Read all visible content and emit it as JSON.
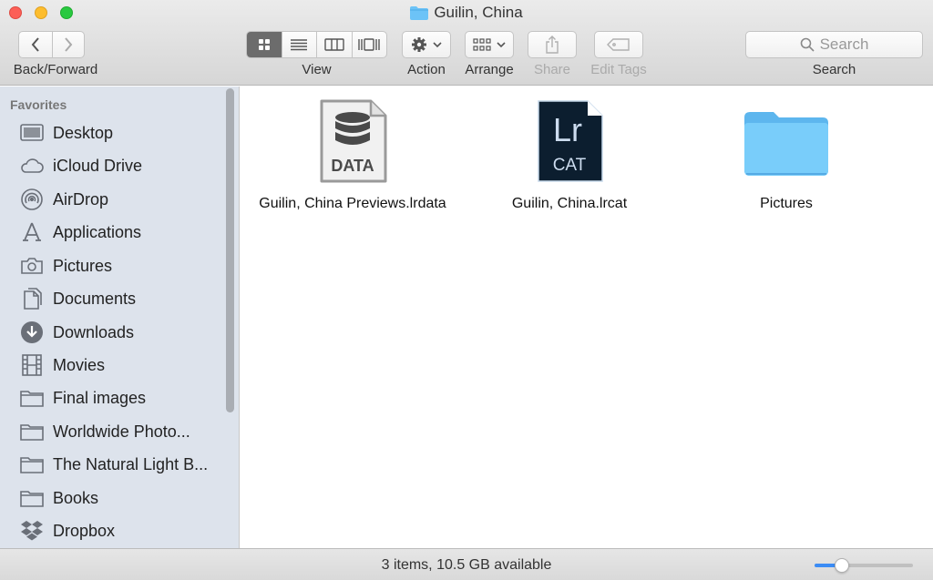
{
  "window": {
    "title": "Guilin, China"
  },
  "toolbar": {
    "nav_label": "Back/Forward",
    "view_label": "View",
    "action_label": "Action",
    "arrange_label": "Arrange",
    "share_label": "Share",
    "edit_tags_label": "Edit Tags",
    "search_label": "Search",
    "search_placeholder": "Search"
  },
  "sidebar": {
    "heading": "Favorites",
    "items": [
      {
        "label": "Desktop",
        "icon": "desktop-icon"
      },
      {
        "label": "iCloud Drive",
        "icon": "cloud-icon"
      },
      {
        "label": "AirDrop",
        "icon": "airdrop-icon"
      },
      {
        "label": "Applications",
        "icon": "applications-icon"
      },
      {
        "label": "Pictures",
        "icon": "camera-icon"
      },
      {
        "label": "Documents",
        "icon": "documents-icon"
      },
      {
        "label": "Downloads",
        "icon": "downloads-icon"
      },
      {
        "label": "Movies",
        "icon": "film-icon"
      },
      {
        "label": "Final images",
        "icon": "folder-icon"
      },
      {
        "label": "Worldwide Photo...",
        "icon": "folder-icon"
      },
      {
        "label": "The Natural Light B...",
        "icon": "folder-icon"
      },
      {
        "label": "Books",
        "icon": "folder-icon"
      },
      {
        "label": "Dropbox",
        "icon": "dropbox-icon"
      }
    ]
  },
  "files": [
    {
      "name": "Guilin, China Previews.lrdata",
      "icon_text": "DATA",
      "icon": "lrdata-file-icon"
    },
    {
      "name": "Guilin, China.lrcat",
      "icon_text_top": "Lr",
      "icon_text_bottom": "CAT",
      "icon": "lrcat-file-icon"
    },
    {
      "name": "Pictures",
      "icon": "folder-icon"
    }
  ],
  "status": {
    "text": "3 items, 10.5 GB available",
    "zoom_level": 0.28
  },
  "colors": {
    "accent": "#3b8cf5",
    "folder": "#6cc3f7",
    "sidebar_bg": "#dde3ec",
    "lr_bg": "#0c1e2f",
    "lr_text": "#ccdcef"
  }
}
